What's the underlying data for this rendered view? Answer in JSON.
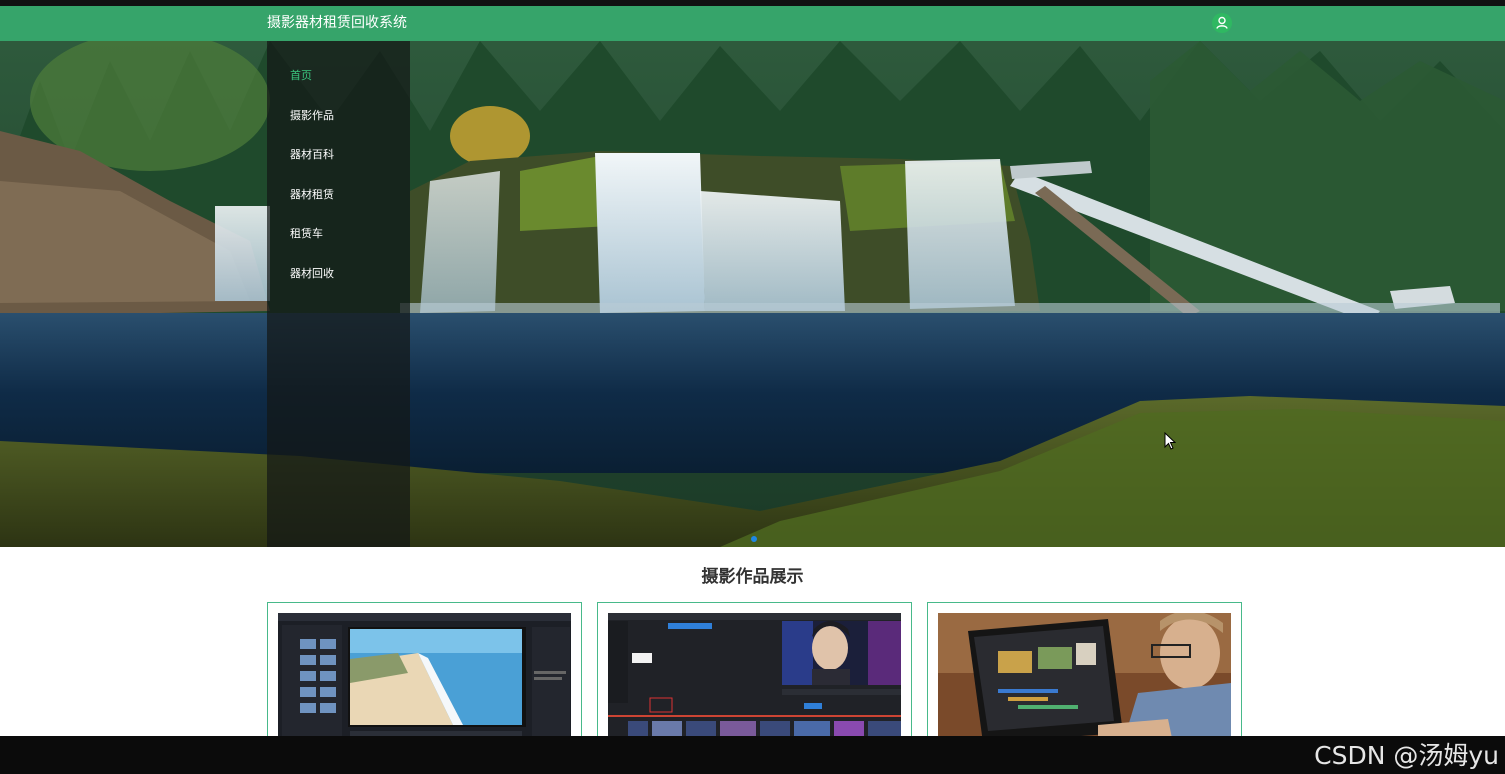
{
  "header": {
    "site_title": "摄影器材租赁回收系统",
    "user_icon": "user-icon",
    "brand_color": "#36a46a"
  },
  "nav": {
    "items": [
      {
        "label": "首页",
        "active": true
      },
      {
        "label": "摄影作品",
        "active": false
      },
      {
        "label": "器材百科",
        "active": false
      },
      {
        "label": "器材租赁",
        "active": false
      },
      {
        "label": "租赁车",
        "active": false
      },
      {
        "label": "器材回收",
        "active": false
      }
    ],
    "active_color": "#3ac47d"
  },
  "banner": {
    "scene": "waterfall-landscape",
    "active_dot_color": "#1e88e5"
  },
  "showcase": {
    "title": "摄影作品展示",
    "cards": [
      {
        "thumb": "photo-editor-screenshot-beach"
      },
      {
        "thumb": "video-editor-screenshot-anime"
      },
      {
        "thumb": "person-editing-video-on-laptop"
      }
    ]
  },
  "watermark": "CSDN @汤姆yu"
}
